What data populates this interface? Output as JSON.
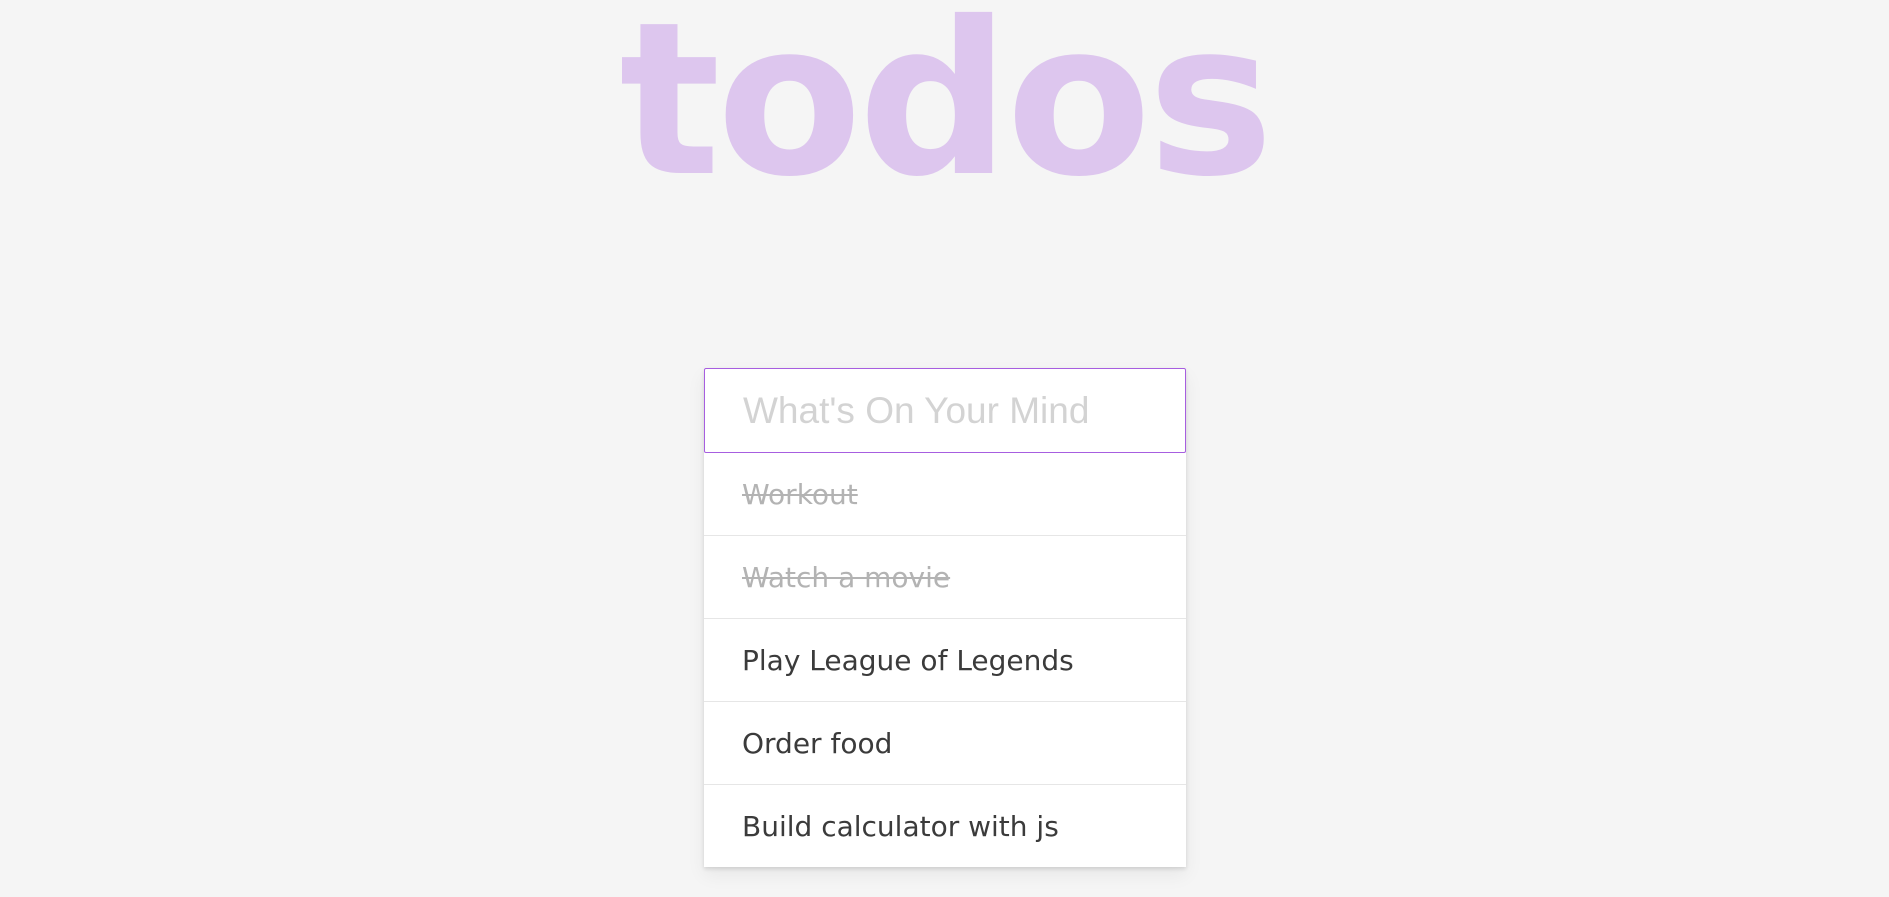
{
  "app": {
    "title": "todos"
  },
  "new_todo": {
    "placeholder": "What's On Your Mind",
    "value": ""
  },
  "todos": [
    {
      "label": "Workout",
      "completed": true
    },
    {
      "label": "Watch a movie",
      "completed": true
    },
    {
      "label": "Play League of Legends",
      "completed": false
    },
    {
      "label": "Order food",
      "completed": false
    },
    {
      "label": "Build calculator with js",
      "completed": false
    }
  ],
  "colors": {
    "background": "#f5f5f5",
    "title": "#ddc6ee",
    "input_border": "#a75ee0",
    "completed_text": "#b3b3b3",
    "active_text": "#3b3b3b"
  }
}
